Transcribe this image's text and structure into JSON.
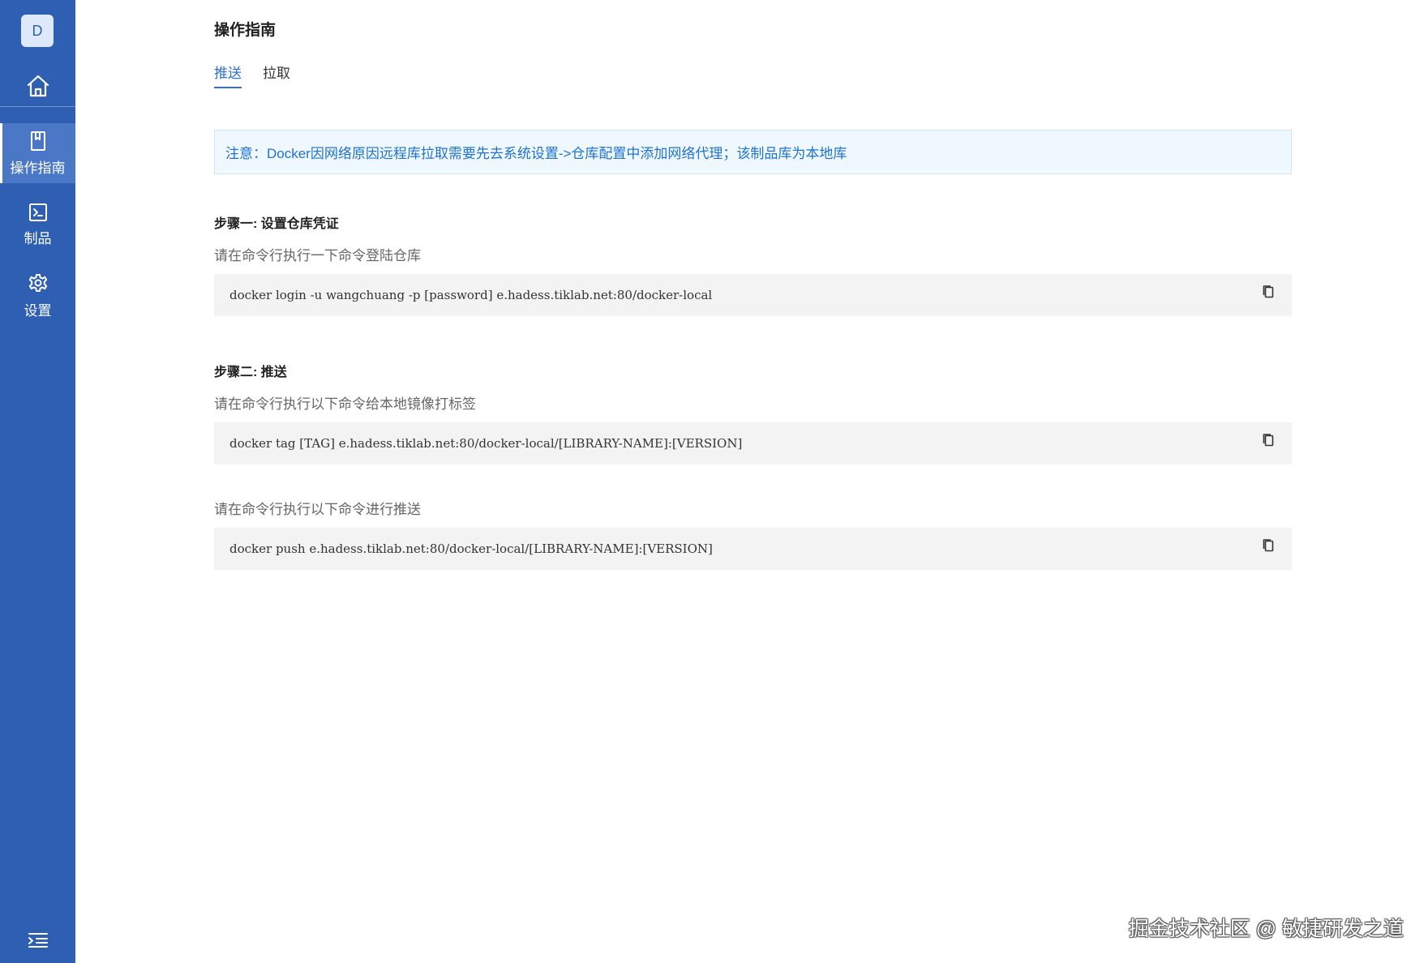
{
  "sidebar": {
    "avatar_letter": "D",
    "home_icon": "home-icon",
    "items": [
      {
        "label": "操作指南",
        "icon": "book-icon",
        "active": true
      },
      {
        "label": "制品",
        "icon": "terminal-icon",
        "active": false
      },
      {
        "label": "设置",
        "icon": "gear-icon",
        "active": false
      }
    ],
    "collapse_icon": "menu-collapse-icon",
    "colors": {
      "background": "#2f5fb3",
      "active": "#4a78c7"
    }
  },
  "main": {
    "title": "操作指南",
    "tabs": [
      {
        "label": "推送",
        "active": true
      },
      {
        "label": "拉取",
        "active": false
      }
    ],
    "notice": "注意：Docker因网络原因远程库拉取需要先去系统设置->仓库配置中添加网络代理；该制品库为本地库",
    "steps": [
      {
        "title": "步骤一: 设置仓库凭证",
        "blocks": [
          {
            "desc": "请在命令行执行一下命令登陆仓库",
            "code": "docker login -u wangchuang -p [password] e.hadess.tiklab.net:80/docker-local"
          }
        ]
      },
      {
        "title": "步骤二: 推送",
        "blocks": [
          {
            "desc": "请在命令行执行以下命令给本地镜像打标签",
            "code": "docker tag [TAG] e.hadess.tiklab.net:80/docker-local/[LIBRARY-NAME]:[VERSION]"
          },
          {
            "desc": "请在命令行执行以下命令进行推送",
            "code": "docker push e.hadess.tiklab.net:80/docker-local/[LIBRARY-NAME]:[VERSION]"
          }
        ]
      }
    ],
    "copy_icon": "copy-icon",
    "accent_color": "#2f6fd6"
  },
  "watermark": "掘金技术社区 @ 敏捷研发之道"
}
